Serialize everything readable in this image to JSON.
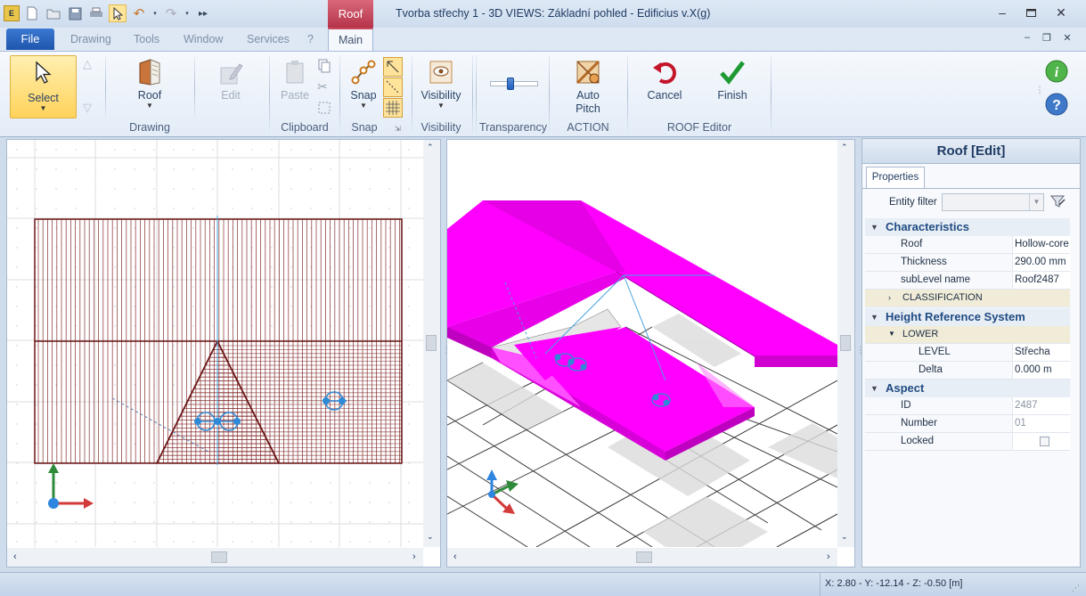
{
  "window": {
    "title": "Tvorba střechy 1 -  3D VIEWS: Základní pohled - Edificius v.X(g)",
    "context_tab": "Roof"
  },
  "ribbon_tabs": {
    "file": "File",
    "drawing": "Drawing",
    "tools": "Tools",
    "window": "Window",
    "services": "Services",
    "help": "?",
    "main": "Main"
  },
  "ribbon": {
    "select": "Select",
    "roof": "Roof",
    "edit": "Edit",
    "paste": "Paste",
    "snap": "Snap",
    "visibility": "Visibility",
    "auto": "Auto",
    "pitch": "Pitch",
    "cancel": "Cancel",
    "finish": "Finish",
    "groups": {
      "drawing": "Drawing",
      "clipboard": "Clipboard",
      "snap": "Snap",
      "visibility": "Visibility",
      "transparency": "Transparency",
      "action": "ACTION",
      "roof_editor": "ROOF Editor"
    },
    "transparency_level": 0.22
  },
  "panel": {
    "title": "Roof [Edit]",
    "tab": "Properties",
    "entity_filter_label": "Entity filter",
    "entity_filter_value": "",
    "categories": {
      "characteristics": "Characteristics",
      "height_ref": "Height Reference System",
      "aspect": "Aspect"
    },
    "rows": {
      "roof": {
        "label": "Roof",
        "value": "Hollow-core s"
      },
      "thickness": {
        "label": "Thickness",
        "value": "290.00 mm"
      },
      "sublevel": {
        "label": "subLevel name",
        "value": "Roof2487"
      },
      "classification": {
        "label": "CLASSIFICATION"
      },
      "lower": {
        "label": "LOWER"
      },
      "level": {
        "label": "LEVEL",
        "value": "Střecha"
      },
      "delta": {
        "label": "Delta",
        "value": "0.000 m"
      },
      "id": {
        "label": "ID",
        "value": "2487"
      },
      "number": {
        "label": "Number",
        "value": "01"
      },
      "locked": {
        "label": "Locked",
        "value": false
      }
    }
  },
  "status": {
    "coords": "X: 2.80 - Y: -12.14 - Z: -0.50 [m]"
  },
  "colors": {
    "roof_3d": "#ff00ff",
    "roof_2d": "#7a1a1a",
    "accent": "#2d6fc4"
  }
}
